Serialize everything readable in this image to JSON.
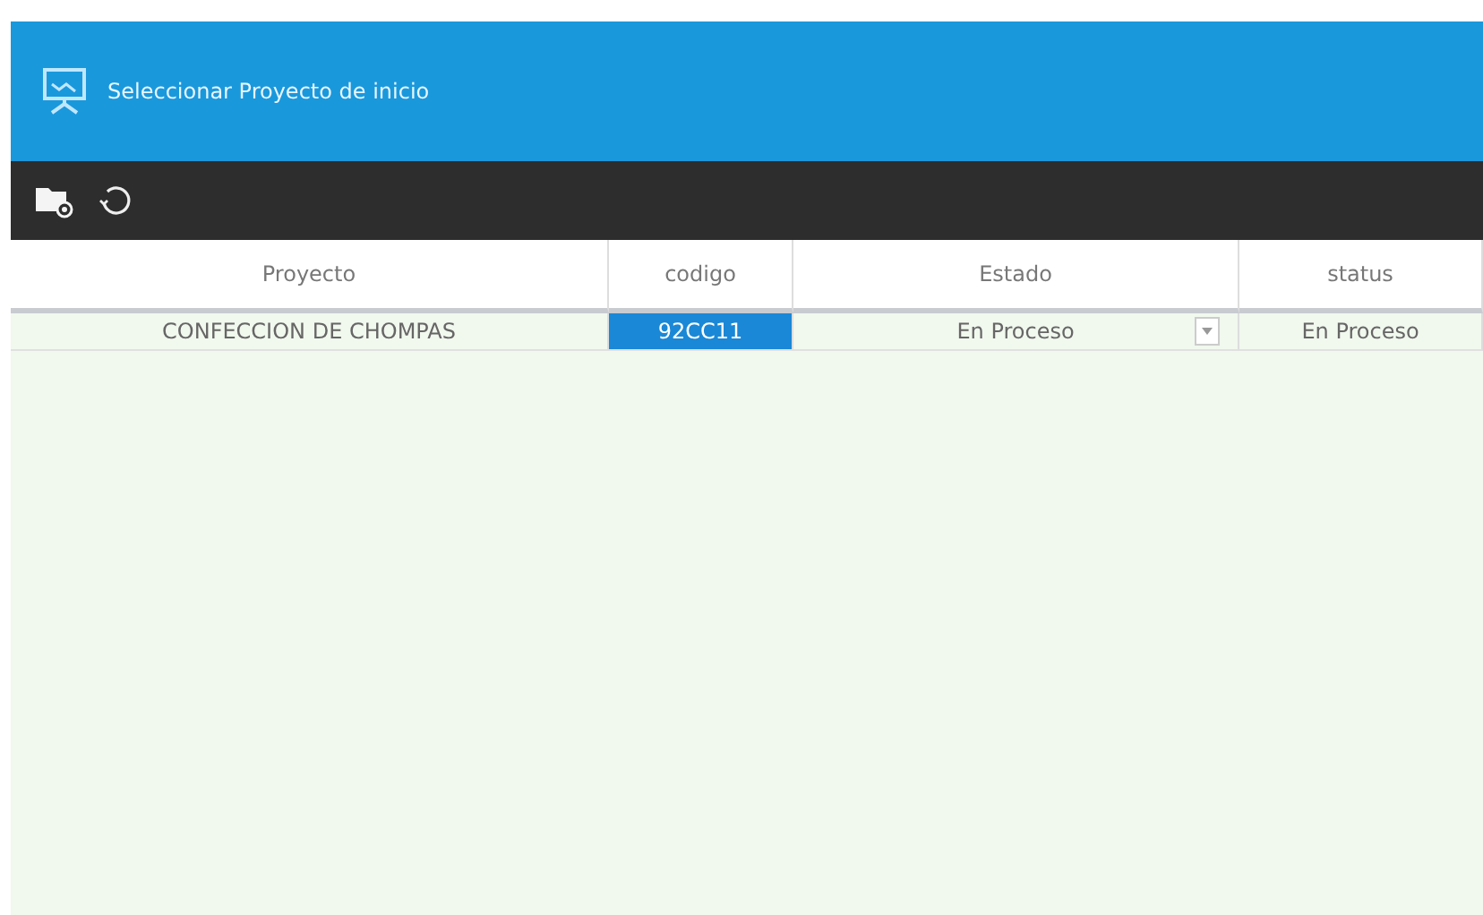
{
  "window": {
    "title": "Seleccionar Proyecto de inicio"
  },
  "toolbar": {
    "buttons": [
      {
        "kind": "new-folder"
      },
      {
        "kind": "refresh"
      }
    ]
  },
  "table": {
    "columns": [
      "Proyecto",
      "codigo",
      "Estado",
      "status"
    ],
    "rows": [
      {
        "proyecto": "CONFECCION DE CHOMPAS",
        "codigo": "92CC11",
        "codigo_selected": true,
        "estado": "En Proceso",
        "status": "En Proceso"
      }
    ]
  }
}
